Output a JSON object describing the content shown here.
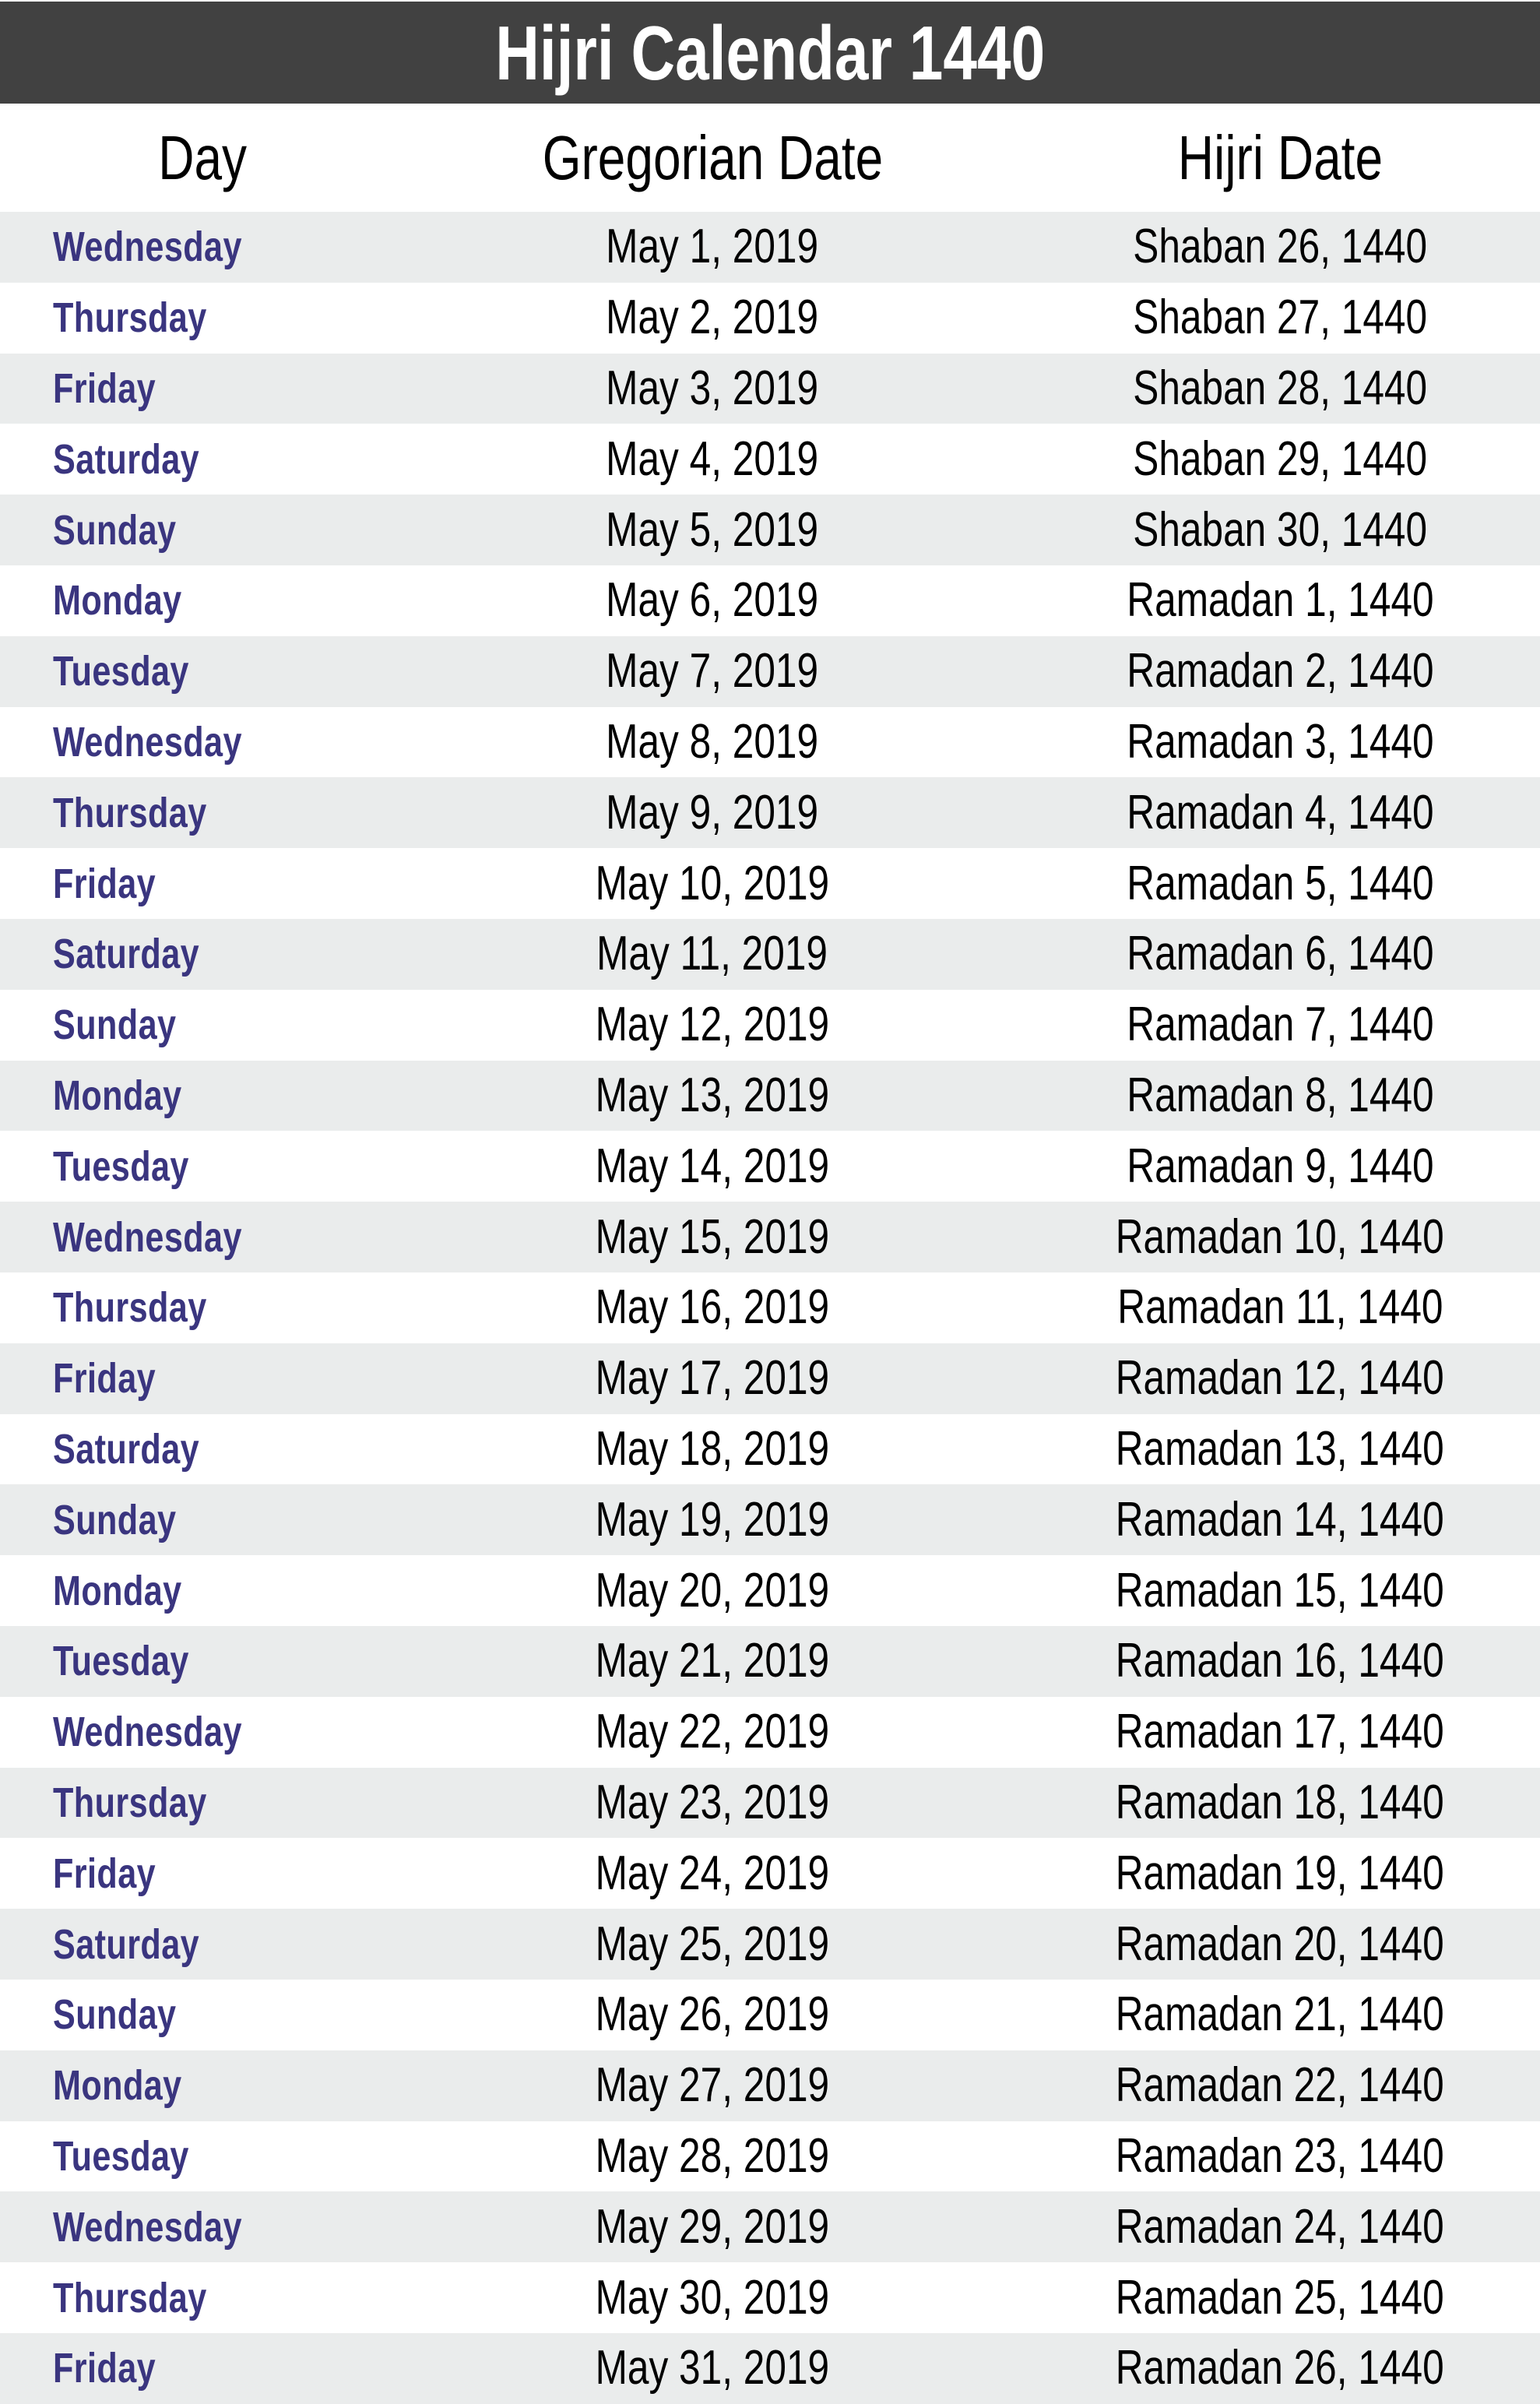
{
  "title": "Hijri Calendar 1440",
  "colors": {
    "title_bar_bg": "#414141",
    "title_text": "#ffffff",
    "row_shaded_bg": "#eaecec",
    "row_plain_bg": "#ffffff",
    "day_text": "#3a357f",
    "date_text": "#000000"
  },
  "columns": {
    "day": "Day",
    "gregorian": "Gregorian Date",
    "hijri": "Hijri Date"
  },
  "rows": [
    {
      "day": "Wednesday",
      "gregorian": "May 1, 2019",
      "hijri": "Shaban 26, 1440"
    },
    {
      "day": "Thursday",
      "gregorian": "May 2, 2019",
      "hijri": "Shaban 27, 1440"
    },
    {
      "day": "Friday",
      "gregorian": "May 3, 2019",
      "hijri": "Shaban 28, 1440"
    },
    {
      "day": "Saturday",
      "gregorian": "May 4, 2019",
      "hijri": "Shaban 29, 1440"
    },
    {
      "day": "Sunday",
      "gregorian": "May 5, 2019",
      "hijri": "Shaban 30, 1440"
    },
    {
      "day": "Monday",
      "gregorian": "May 6, 2019",
      "hijri": "Ramadan 1, 1440"
    },
    {
      "day": "Tuesday",
      "gregorian": "May 7, 2019",
      "hijri": "Ramadan 2, 1440"
    },
    {
      "day": "Wednesday",
      "gregorian": "May 8, 2019",
      "hijri": "Ramadan 3, 1440"
    },
    {
      "day": "Thursday",
      "gregorian": "May 9, 2019",
      "hijri": "Ramadan 4, 1440"
    },
    {
      "day": "Friday",
      "gregorian": "May 10, 2019",
      "hijri": "Ramadan 5, 1440"
    },
    {
      "day": "Saturday",
      "gregorian": "May 11, 2019",
      "hijri": "Ramadan 6, 1440"
    },
    {
      "day": "Sunday",
      "gregorian": "May 12, 2019",
      "hijri": "Ramadan 7, 1440"
    },
    {
      "day": "Monday",
      "gregorian": "May 13, 2019",
      "hijri": "Ramadan 8, 1440"
    },
    {
      "day": "Tuesday",
      "gregorian": "May 14, 2019",
      "hijri": "Ramadan 9, 1440"
    },
    {
      "day": "Wednesday",
      "gregorian": "May 15, 2019",
      "hijri": "Ramadan 10, 1440"
    },
    {
      "day": "Thursday",
      "gregorian": "May 16, 2019",
      "hijri": "Ramadan 11, 1440"
    },
    {
      "day": "Friday",
      "gregorian": "May 17, 2019",
      "hijri": "Ramadan 12, 1440"
    },
    {
      "day": "Saturday",
      "gregorian": "May 18, 2019",
      "hijri": "Ramadan 13, 1440"
    },
    {
      "day": "Sunday",
      "gregorian": "May 19, 2019",
      "hijri": "Ramadan 14, 1440"
    },
    {
      "day": "Monday",
      "gregorian": "May 20, 2019",
      "hijri": "Ramadan 15, 1440"
    },
    {
      "day": "Tuesday",
      "gregorian": "May 21, 2019",
      "hijri": "Ramadan 16, 1440"
    },
    {
      "day": "Wednesday",
      "gregorian": "May 22, 2019",
      "hijri": "Ramadan 17, 1440"
    },
    {
      "day": "Thursday",
      "gregorian": "May 23, 2019",
      "hijri": "Ramadan 18, 1440"
    },
    {
      "day": "Friday",
      "gregorian": "May 24, 2019",
      "hijri": "Ramadan 19, 1440"
    },
    {
      "day": "Saturday",
      "gregorian": "May 25, 2019",
      "hijri": "Ramadan 20, 1440"
    },
    {
      "day": "Sunday",
      "gregorian": "May 26, 2019",
      "hijri": "Ramadan 21, 1440"
    },
    {
      "day": "Monday",
      "gregorian": "May 27, 2019",
      "hijri": "Ramadan 22, 1440"
    },
    {
      "day": "Tuesday",
      "gregorian": "May 28, 2019",
      "hijri": "Ramadan 23, 1440"
    },
    {
      "day": "Wednesday",
      "gregorian": "May 29, 2019",
      "hijri": "Ramadan 24, 1440"
    },
    {
      "day": "Thursday",
      "gregorian": "May 30, 2019",
      "hijri": "Ramadan 25, 1440"
    },
    {
      "day": "Friday",
      "gregorian": "May 31, 2019",
      "hijri": "Ramadan 26, 1440"
    }
  ]
}
